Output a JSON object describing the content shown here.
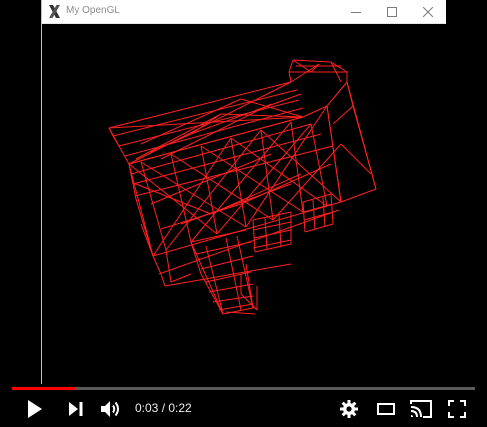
{
  "window": {
    "title": "My OpenGL",
    "icon": "x-app-icon",
    "controls": [
      "minimize-icon",
      "maximize-icon",
      "close-icon"
    ]
  },
  "scene": {
    "description_type": "wireframe-house",
    "wire_color": "#ff2020",
    "background": "#000000"
  },
  "player": {
    "time_current": "0:03",
    "time_separator": " / ",
    "time_total": "0:22",
    "progress_fraction": 0.136,
    "progress_color": "#ff0000",
    "icons": [
      "play-icon",
      "next-icon",
      "volume-icon",
      "settings-icon",
      "theater-mode-icon",
      "cast-icon",
      "fullscreen-icon"
    ]
  }
}
